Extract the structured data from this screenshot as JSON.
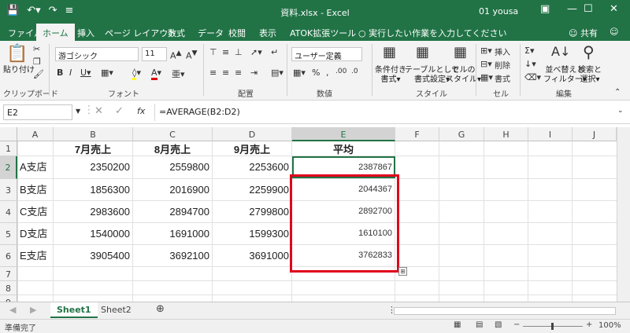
{
  "title_bar": {
    "title": "資料.xlsx  -  Excel",
    "user": "01 yousa",
    "qat_icons": [
      "save-icon",
      "undo-icon",
      "redo-icon",
      "customize-icon"
    ],
    "window_controls": [
      "ribbon-display-icon",
      "minimize-icon",
      "maximize-icon",
      "close-icon"
    ]
  },
  "ribbon_tabs": {
    "items": [
      "ファイル",
      "ホーム",
      "挿入",
      "ページ レイアウト",
      "数式",
      "データ",
      "校閲",
      "表示",
      "ATOK拡張ツール"
    ],
    "active": "ホーム",
    "tell_me": "実行したい作業を入力してください",
    "share": "共有"
  },
  "ribbon": {
    "clipboard": {
      "paste": "貼り付け",
      "label": "クリップボード"
    },
    "font": {
      "name": "游ゴシック",
      "size": "11",
      "label": "フォント"
    },
    "alignment": {
      "label": "配置"
    },
    "number": {
      "format": "ユーザー定義",
      "label": "数値"
    },
    "styles": {
      "conditional": "条件付き\n書式▾",
      "table": "テーブルとして\n書式設定▾",
      "cell": "セルの\nスタイル▾",
      "label": "スタイル"
    },
    "cells": {
      "insert": "挿入",
      "delete": "削除",
      "format": "書式",
      "label": "セル"
    },
    "editing": {
      "sort": "並べ替えと\nフィルター▾",
      "find": "検索と\n選択▾",
      "label": "編集"
    }
  },
  "formula_bar": {
    "name_box": "E2",
    "fx": "fx",
    "formula": "=AVERAGE(B2:D2)"
  },
  "grid": {
    "columns": [
      "A",
      "B",
      "C",
      "D",
      "E",
      "F",
      "G",
      "H",
      "I",
      "J"
    ],
    "rows": [
      "1",
      "2",
      "3",
      "4",
      "5",
      "6",
      "7",
      "8",
      "9"
    ],
    "headers": [
      "7月売上",
      "8月売上",
      "9月売上",
      "平均"
    ],
    "data": [
      {
        "store": "A支店",
        "jul": "2350200",
        "aug": "2559800",
        "sep": "2253600",
        "avg": "2387867"
      },
      {
        "store": "B支店",
        "jul": "1856300",
        "aug": "2016900",
        "sep": "2259900",
        "avg": "2044367"
      },
      {
        "store": "C支店",
        "jul": "2983600",
        "aug": "2894700",
        "sep": "2799800",
        "avg": "2892700"
      },
      {
        "store": "D支店",
        "jul": "1540000",
        "aug": "1691000",
        "sep": "1599300",
        "avg": "1610100"
      },
      {
        "store": "E支店",
        "jul": "3905400",
        "aug": "3692100",
        "sep": "3691000",
        "avg": "3762833"
      }
    ]
  },
  "sheet_tabs": {
    "items": [
      "Sheet1",
      "Sheet2"
    ],
    "active": "Sheet1"
  },
  "status_bar": {
    "ready": "準備完了",
    "zoom": "100%"
  }
}
